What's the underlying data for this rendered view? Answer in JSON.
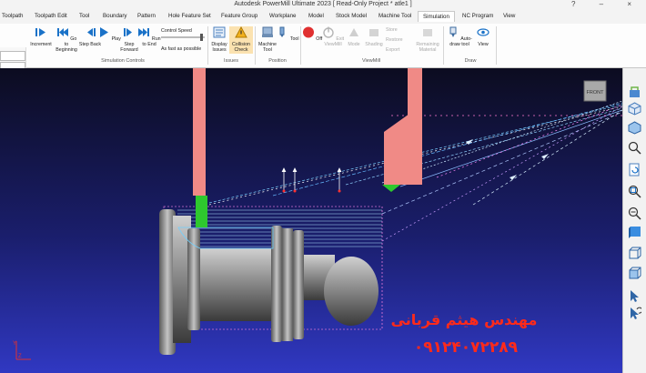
{
  "window": {
    "title": "Autodesk PowerMill Ultimate 2023   [ Read-Only Project * atle1 ]",
    "controls": "?  –  ×"
  },
  "tabs": [
    {
      "label": "Toolpath"
    },
    {
      "label": "Toolpath Edit"
    },
    {
      "label": "Tool"
    },
    {
      "label": "Boundary"
    },
    {
      "label": "Pattern"
    },
    {
      "label": "Hole Feature Set"
    },
    {
      "label": "Feature Group"
    },
    {
      "label": "Workplane"
    },
    {
      "label": "Model"
    },
    {
      "label": "Stock Model"
    },
    {
      "label": "Machine Tool"
    },
    {
      "label": "Simulation"
    },
    {
      "label": "NC Program"
    },
    {
      "label": "View"
    }
  ],
  "ribbon": {
    "sim_controls": {
      "increment": "Increment",
      "go_to_beginning": "Go to Beginning",
      "step_back": "Step Back",
      "play": "Play",
      "step_forward": "Step Forward",
      "run_to_end": "Run to End",
      "control_speed": "Control Speed",
      "as_fast": "As fast as possible",
      "group": "Simulation Controls"
    },
    "issues": {
      "display_issues": "Display Issues",
      "collision_check": "Collision Check",
      "group": "Issues"
    },
    "position": {
      "machine_tool": "Machine Tool",
      "tool": "Tool",
      "group": "Position"
    },
    "viewmill": {
      "off": "Off",
      "exit_viewmill": "Exit ViewMill",
      "mode": "Mode",
      "shading": "Shading",
      "store": "Store",
      "restore": "Restore",
      "export": "Export",
      "remaining_material": "Remaining Material",
      "group": "ViewMill"
    },
    "draw": {
      "auto_draw_tool": "Auto-draw tool",
      "view": "View",
      "group": "Draw"
    }
  },
  "viewport": {
    "watermark_name": "مهندس هیثم قربانی",
    "watermark_phone": "۰۹۱۲۴۰۷۲۲۸۹",
    "view_cube_label": "FRONT",
    "axis_labels": [
      "Y",
      "Z"
    ],
    "colors": {
      "bg_top": "#0c0c20",
      "bg_bottom": "#3038c2",
      "tool": "#f08a86",
      "insert": "#2ec82e",
      "watermark": "#ff2a1a"
    }
  }
}
